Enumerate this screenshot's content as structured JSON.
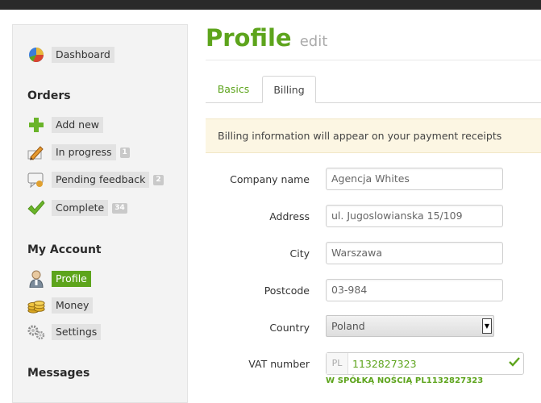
{
  "sidebar": {
    "dashboard": "Dashboard",
    "orders_heading": "Orders",
    "orders": [
      {
        "label": "Add new",
        "count": ""
      },
      {
        "label": "In progress",
        "count": "1"
      },
      {
        "label": "Pending feedback",
        "count": "2"
      },
      {
        "label": "Complete",
        "count": "34"
      }
    ],
    "account_heading": "My Account",
    "account": [
      {
        "label": "Profile",
        "active": true
      },
      {
        "label": "Money",
        "active": false
      },
      {
        "label": "Settings",
        "active": false
      }
    ],
    "messages_heading": "Messages"
  },
  "page": {
    "title": "Profile",
    "edit_link": "edit"
  },
  "tabs": [
    {
      "label": "Basics",
      "active": false
    },
    {
      "label": "Billing",
      "active": true
    }
  ],
  "info_message": "Billing information will appear on your payment receipts",
  "form": {
    "company_label": "Company name",
    "company_value": "Agencja Whites",
    "address_label": "Address",
    "address_value": "ul. Jugoslowianska 15/109",
    "city_label": "City",
    "city_value": "Warszawa",
    "postcode_label": "Postcode",
    "postcode_value": "03-984",
    "country_label": "Country",
    "country_value": "Poland",
    "vat_label": "VAT number",
    "vat_prefix": "PL",
    "vat_value": "1132827323",
    "vat_hint": "W SPÓŁKĄ NOŚCIĄ PL1132827323"
  },
  "colors": {
    "accent": "#5da41c",
    "info_bg": "#fcf6e3"
  }
}
